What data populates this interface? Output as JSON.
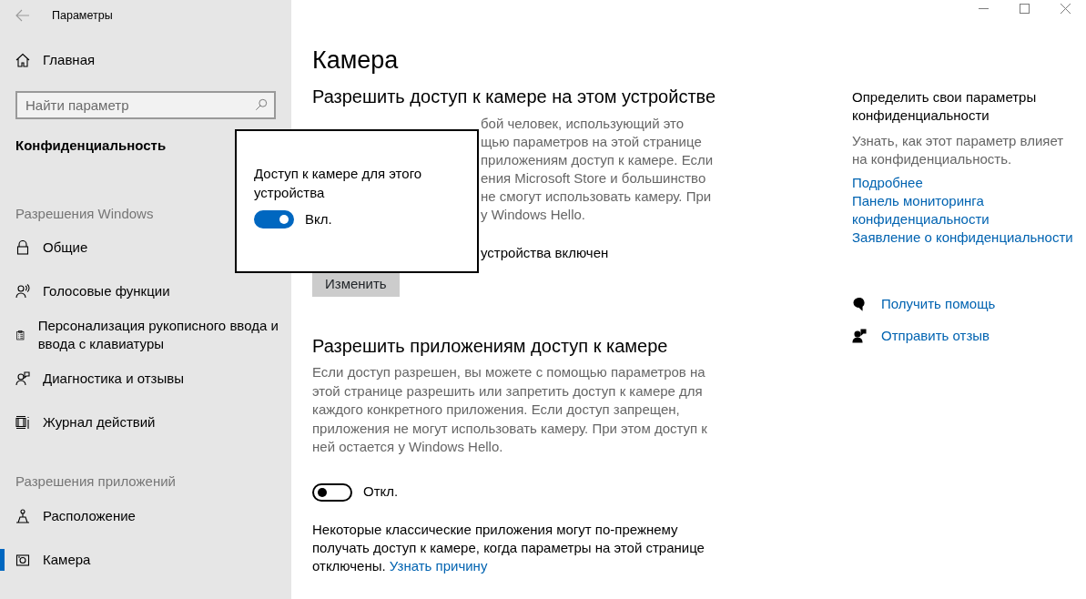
{
  "window": {
    "title": "Параметры"
  },
  "sidebar": {
    "home": {
      "label": "Главная"
    },
    "search": {
      "placeholder": "Найти параметр"
    },
    "section_title": "Конфиденциальность",
    "groups": [
      {
        "heading": "Разрешения Windows",
        "items": [
          {
            "label": "Общие",
            "selected": false
          },
          {
            "label": "Голосовые функции",
            "selected": false
          },
          {
            "label": "Персонализация рукописного ввода и ввода с клавиатуры",
            "selected": false
          },
          {
            "label": "Диагностика и отзывы",
            "selected": false
          },
          {
            "label": "Журнал действий",
            "selected": false
          }
        ]
      },
      {
        "heading": "Разрешения приложений",
        "items": [
          {
            "label": "Расположение",
            "selected": false
          },
          {
            "label": "Камера",
            "selected": true
          }
        ]
      }
    ]
  },
  "page": {
    "title": "Камера",
    "device_section": {
      "heading": "Разрешить доступ к камере на этом устройстве",
      "visible_fragments": [
        "бой человек, использующий это",
        "щью параметров на этой странице",
        "приложениям доступ к камере. Если",
        "ения Microsoft Store и большинство",
        "не смогут использовать камеру. При",
        "у Windows Hello."
      ],
      "status_fragment": "устройства включен",
      "button": "Изменить"
    },
    "popup": {
      "text": "Доступ к камере для этого устройства",
      "toggle": {
        "on": true,
        "label": "Вкл."
      }
    },
    "apps_section": {
      "heading": "Разрешить приложениям доступ к камере",
      "description": "Если доступ разрешен, вы можете с помощью параметров на этой странице разрешить или запретить доступ к камере для каждого конкретного приложения. Если доступ запрещен, приложения не могут использовать камеру. При этом доступ к ней остается у Windows Hello.",
      "toggle": {
        "on": false,
        "label": "Откл."
      },
      "note": "Некоторые классические приложения могут по-прежнему получать доступ к камере, когда параметры на этой странице отключены.",
      "note_link": "Узнать причину"
    }
  },
  "aside": {
    "heading": "Определить свои параметры конфиденциальности",
    "description": "Узнать, как этот параметр влияет на конфиденциальность.",
    "links": [
      "Подробнее",
      "Панель мониторинга конфиденциальности",
      "Заявление о конфиденциальности"
    ],
    "actions": [
      {
        "label": "Получить помощь"
      },
      {
        "label": "Отправить отзыв"
      }
    ]
  }
}
